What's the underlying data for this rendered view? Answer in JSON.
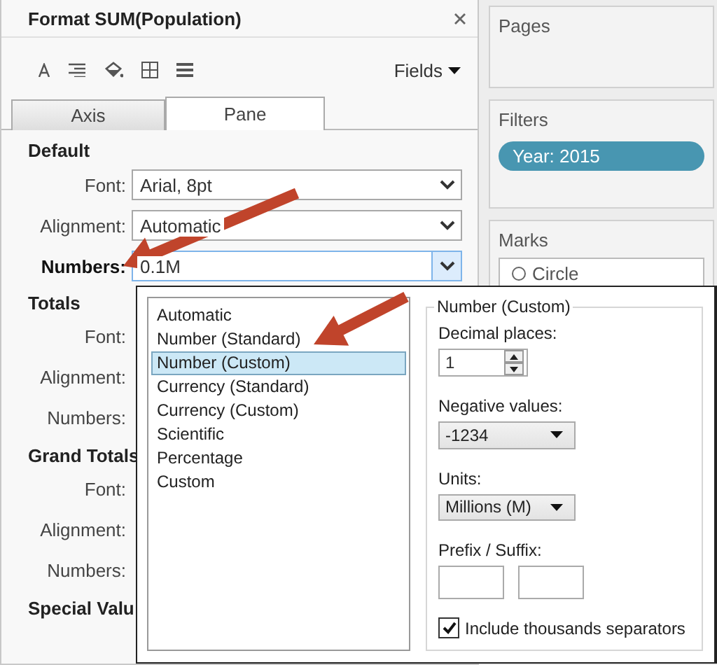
{
  "panel": {
    "title": "Format SUM(Population)",
    "fields_menu": "Fields"
  },
  "tabs": [
    {
      "label": "Axis",
      "selected": false
    },
    {
      "label": "Pane",
      "selected": true
    }
  ],
  "sections": [
    {
      "title": "Default",
      "rows": [
        {
          "label": "Font:",
          "value": "Arial, 8pt",
          "focused": false
        },
        {
          "label": "Alignment:",
          "value": "Automatic",
          "focused": false
        },
        {
          "label": "Numbers:",
          "value": "0.1M",
          "focused": true
        }
      ]
    },
    {
      "title": "Totals",
      "rows": [
        {
          "label": "Font:",
          "focused": false
        },
        {
          "label": "Alignment:",
          "focused": false
        },
        {
          "label": "Numbers:",
          "focused": false
        }
      ]
    },
    {
      "title": "Grand Totals",
      "rows": [
        {
          "label": "Font:",
          "focused": false
        },
        {
          "label": "Alignment:",
          "focused": false
        },
        {
          "label": "Numbers:",
          "focused": false
        }
      ]
    },
    {
      "title": "Special Valu"
    }
  ],
  "shelves": [
    {
      "title": "Pages"
    },
    {
      "title": "Filters",
      "pills": [
        "Year: 2015"
      ]
    },
    {
      "title": "Marks",
      "mark_type": "Circle"
    }
  ],
  "dropdown": {
    "options": [
      {
        "label": "Automatic",
        "selected": false
      },
      {
        "label": "Number (Standard)",
        "selected": false
      },
      {
        "label": "Number (Custom)",
        "selected": true
      },
      {
        "label": "Currency (Standard)",
        "selected": false
      },
      {
        "label": "Currency (Custom)",
        "selected": false
      },
      {
        "label": "Scientific",
        "selected": false
      },
      {
        "label": "Percentage",
        "selected": false
      },
      {
        "label": "Custom",
        "selected": false
      }
    ],
    "group": {
      "title": "Number (Custom)",
      "decimal_label": "Decimal places:",
      "decimal_value": "1",
      "negative_label": "Negative values:",
      "negative_value": "-1234",
      "units_label": "Units:",
      "units_value": "Millions (M)",
      "affix_label": "Prefix / Suffix:",
      "separators": {
        "label": "Include thousands separators",
        "checked": true
      }
    }
  }
}
